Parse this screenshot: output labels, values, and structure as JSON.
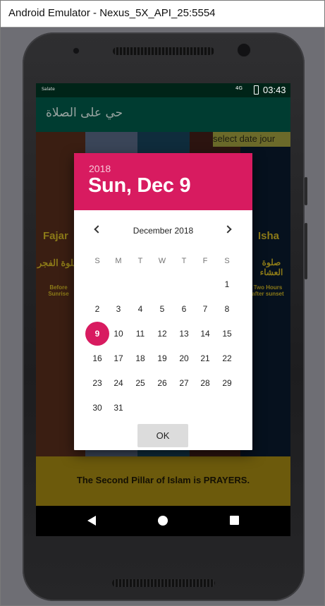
{
  "window": {
    "title": "Android Emulator - Nexus_5X_API_25:5554"
  },
  "statusbar": {
    "app_name": "Salate",
    "signal": "4G",
    "time": "03:43"
  },
  "appbar": {
    "title": "حي على الصلاة"
  },
  "content": {
    "date_strip": "select date jour",
    "cards": {
      "fajar_title": "Fajar",
      "fajar_arabic": "صلوة الفجر",
      "fajar_time": "Before Sunrise",
      "isha_title": "Isha",
      "isha_arabic": "صلوة العشاء",
      "isha_time": "Two Hours after sunset"
    },
    "banner": "The Second Pillar of Islam is PRAYERS."
  },
  "colors": {
    "accent": "#d81b60",
    "appbar": "#003c31",
    "statusbar": "#002418",
    "dialog_bg": "#ffffff",
    "ok_button": "#dcdcdc"
  },
  "date_picker": {
    "header_year": "2018",
    "header_date": "Sun, Dec 9",
    "month_label": "December 2018",
    "prev_icon": "chevron-left-icon",
    "next_icon": "chevron-right-icon",
    "weekdays": [
      "S",
      "M",
      "T",
      "W",
      "T",
      "F",
      "S"
    ],
    "first_weekday_index": 6,
    "days_in_month": 31,
    "selected_day": 9,
    "ok_label": "OK"
  },
  "navbar": {
    "back_icon": "back-triangle-icon",
    "home_icon": "home-circle-icon",
    "recents_icon": "recents-square-icon"
  }
}
